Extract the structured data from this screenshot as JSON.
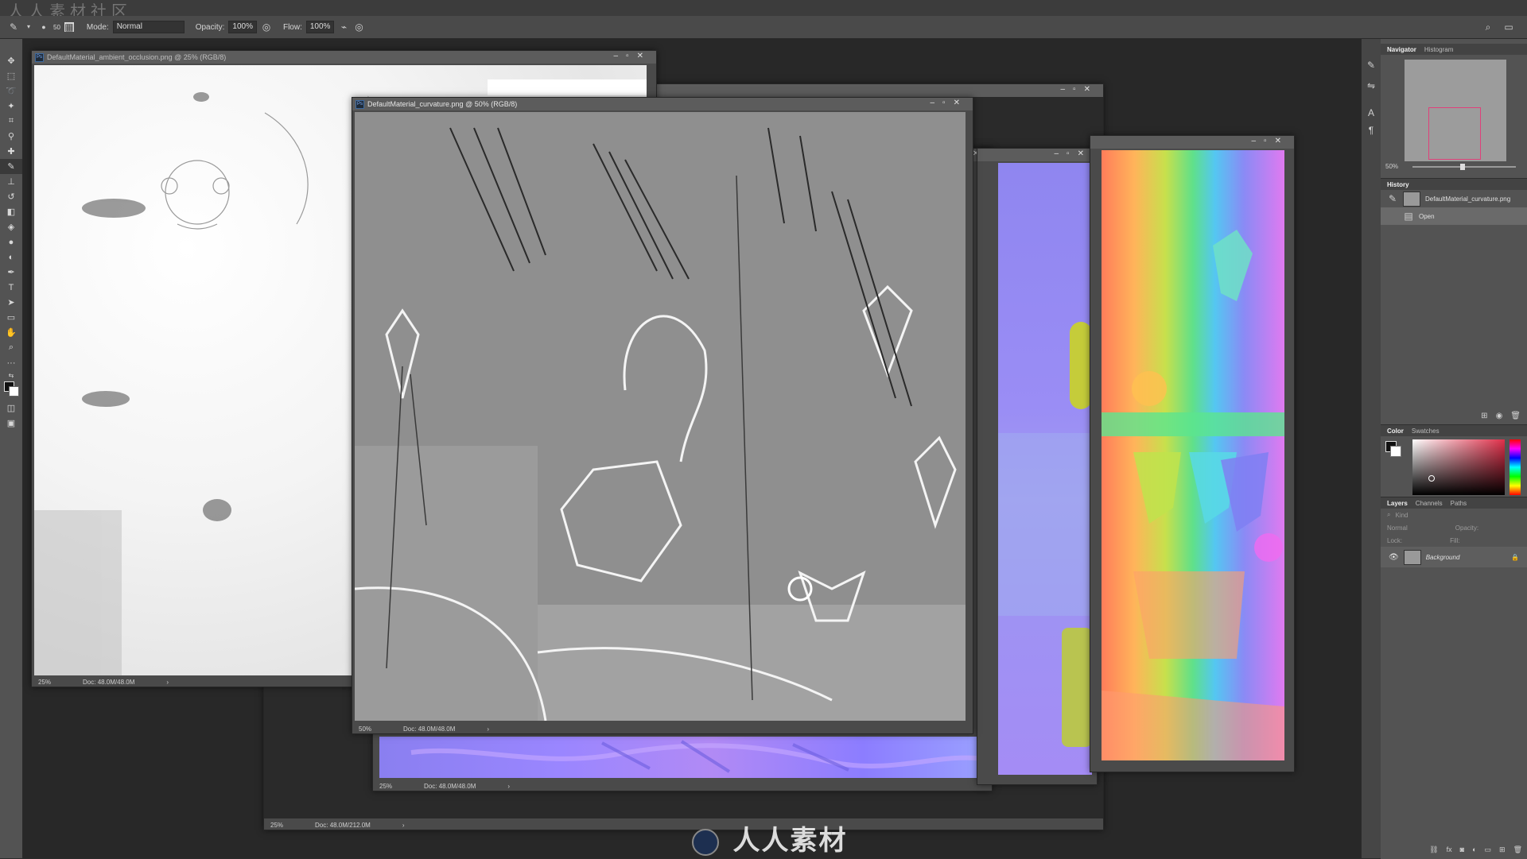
{
  "watermark_top": "人人素材社区",
  "options_bar": {
    "mode_label": "Mode:",
    "mode_value": "Normal",
    "opacity_label": "Opacity:",
    "opacity_value": "100%",
    "flow_label": "Flow:",
    "flow_value": "100%",
    "brush_size": "50"
  },
  "windows": {
    "ambient": {
      "title": "DefaultMaterial_ambient_occlusion.png @ 25% (RGB/8)",
      "zoom": "25%",
      "doc": "Doc: 48.0M/48.0M"
    },
    "curvature": {
      "title": "DefaultMaterial_curvature.png @ 50% (RGB/8)",
      "zoom": "50%",
      "doc": "Doc: 48.0M/48.0M"
    },
    "normal_bottom": {
      "zoom": "25%",
      "doc": "Doc: 48.0M/48.0M"
    },
    "back": {
      "zoom": "25%",
      "doc": "Doc: 48.0M/212.0M"
    }
  },
  "panels": {
    "navigator_tab": "Navigator",
    "histogram_tab": "Histogram",
    "nav_zoom": "50%",
    "history_tab": "History",
    "history_items": [
      "DefaultMaterial_curvature.png",
      "Open"
    ],
    "color_tab": "Color",
    "swatches_tab": "Swatches",
    "layers_tab": "Layers",
    "channels_tab": "Channels",
    "paths_tab": "Paths",
    "kind_label": "Kind",
    "blend_label": "Normal",
    "opacity_label": "Opacity:",
    "lock_label": "Lock:",
    "fill_label": "Fill:",
    "layer_name": "Background"
  },
  "watermark_bottom": "人人素材",
  "colors": {
    "accent": "#2f7ed8",
    "normal_map_base": "#8080ff"
  }
}
